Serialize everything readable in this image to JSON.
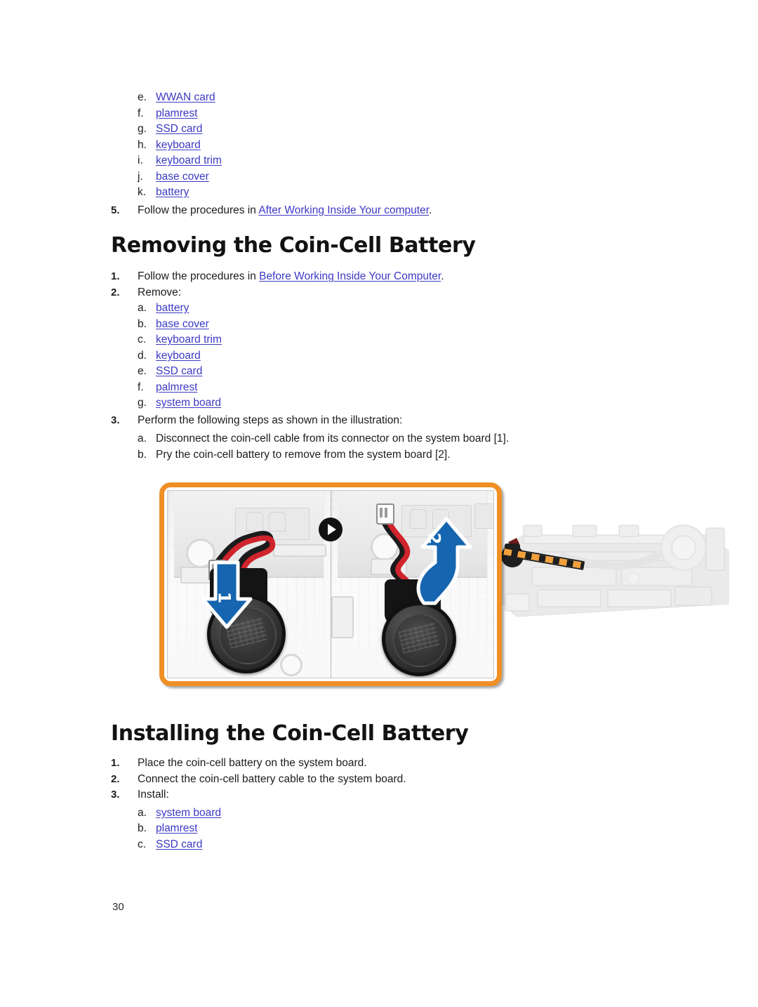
{
  "document": {
    "page_number": "30"
  },
  "top_list": {
    "items": [
      {
        "marker": "e.",
        "label": "WWAN card",
        "link": true
      },
      {
        "marker": "f.",
        "label": "plamrest",
        "link": true
      },
      {
        "marker": "g.",
        "label": "SSD card",
        "link": true
      },
      {
        "marker": "h.",
        "label": "keyboard",
        "link": true
      },
      {
        "marker": "i.",
        "label": "keyboard trim",
        "link": true
      },
      {
        "marker": "j.",
        "label": "base cover",
        "link": true
      },
      {
        "marker": "k.",
        "label": "battery",
        "link": true
      }
    ]
  },
  "step5": {
    "marker": "5.",
    "text_before": "Follow the procedures in ",
    "link": "After Working Inside Your computer",
    "text_after": "."
  },
  "removing": {
    "title": "Removing the Coin-Cell Battery",
    "step1": {
      "marker": "1.",
      "text_before": "Follow the procedures in ",
      "link": "Before Working Inside Your Computer",
      "text_after": "."
    },
    "step2": {
      "marker": "2.",
      "text": "Remove:",
      "items": [
        {
          "marker": "a.",
          "label": "battery"
        },
        {
          "marker": "b.",
          "label": "base cover"
        },
        {
          "marker": "c.",
          "label": "keyboard trim"
        },
        {
          "marker": "d.",
          "label": "keyboard"
        },
        {
          "marker": "e.",
          "label": "SSD card"
        },
        {
          "marker": "f.",
          "label": "palmrest"
        },
        {
          "marker": "g.",
          "label": "system board"
        }
      ]
    },
    "step3": {
      "marker": "3.",
      "text": "Perform the following steps as shown in the illustration:",
      "items": [
        {
          "marker": "a.",
          "label": "Disconnect the coin-cell cable from its connector on the system board [1]."
        },
        {
          "marker": "b.",
          "label": "Pry the coin-cell battery to remove from the system board [2]."
        }
      ]
    }
  },
  "figure": {
    "callout_1": "1",
    "callout_2": "2"
  },
  "installing": {
    "title": "Installing the Coin-Cell Battery",
    "steps": [
      {
        "marker": "1.",
        "text": "Place the coin-cell battery on the system board."
      },
      {
        "marker": "2.",
        "text": "Connect the coin-cell battery cable to the system board."
      },
      {
        "marker": "3.",
        "text": "Install:"
      }
    ],
    "install_items": [
      {
        "marker": "a.",
        "label": "system board"
      },
      {
        "marker": "b.",
        "label": "plamrest"
      },
      {
        "marker": "c.",
        "label": "SSD card"
      }
    ]
  },
  "colors": {
    "link": "#3b39c4",
    "callout_orange": "#ef8f25",
    "arrow_blue": "#1565b0",
    "text": "#1c1c1c"
  }
}
